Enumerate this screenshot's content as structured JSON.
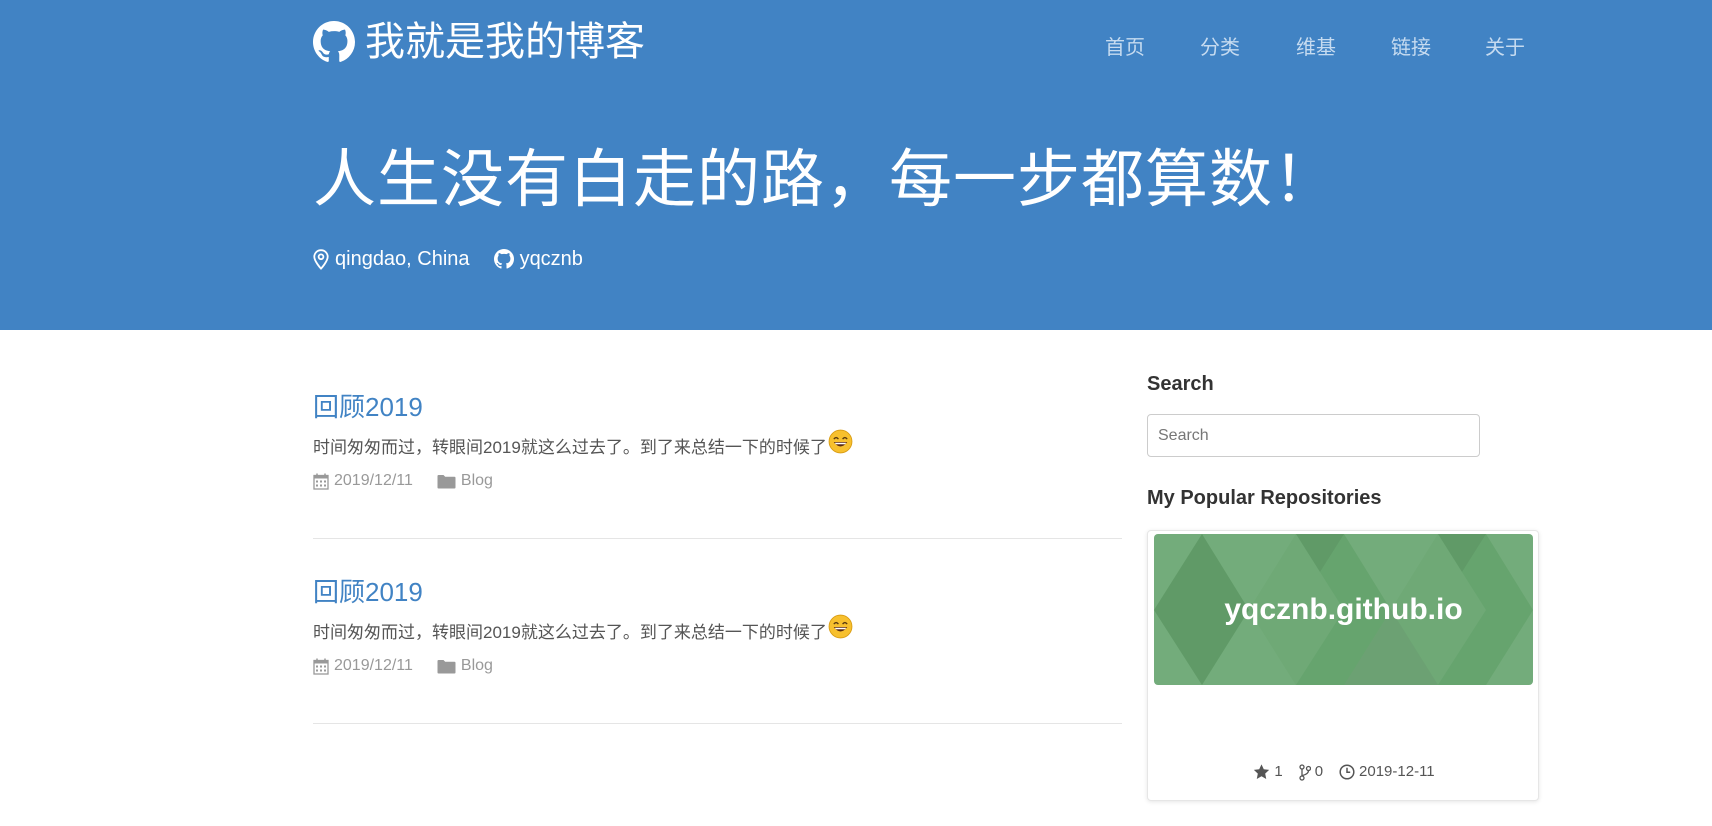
{
  "header": {
    "site_title": "我就是我的博客",
    "nav": [
      "首页",
      "分类",
      "维基",
      "链接",
      "关于"
    ],
    "slogan": "人生没有白走的路，每一步都算数！",
    "location": "qingdao, China",
    "github_user": "yqcznb"
  },
  "posts": [
    {
      "title": "回顾2019",
      "excerpt": "时间匆匆而过，转眼间2019就这么过去了。到了来总结一下的时候了",
      "date": "2019/12/11",
      "category": "Blog"
    },
    {
      "title": "回顾2019",
      "excerpt": "时间匆匆而过，转眼间2019就这么过去了。到了来总结一下的时候了",
      "date": "2019/12/11",
      "category": "Blog"
    }
  ],
  "sidebar": {
    "search_heading": "Search",
    "search_placeholder": "Search",
    "repos_heading": "My Popular Repositories",
    "repos": [
      {
        "name": "yqcznb.github.io",
        "stars": "1",
        "forks": "0",
        "updated": "2019-12-11"
      }
    ]
  },
  "colors": {
    "header_bg": "#4183c4",
    "link": "#4183c4",
    "repo_banner": "#66a46e"
  }
}
